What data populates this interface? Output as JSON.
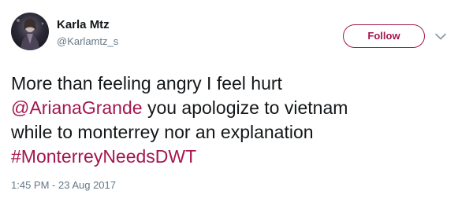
{
  "author": {
    "display_name": "Karla Mtz",
    "handle": "@Karlamtz_s"
  },
  "follow_label": "Follow",
  "tweet": {
    "line1": "More than feeling angry I feel hurt",
    "mention": "@ArianaGrande",
    "line2_rest": " you apologize to vietnam",
    "line3": "while to monterrey nor an explanation",
    "hashtag": "#MonterreyNeedsDWT"
  },
  "timestamp": "1:45 PM - 23 Aug 2017",
  "colors": {
    "accent": "#a3174f",
    "text": "#14171a",
    "secondary": "#657786"
  },
  "icons": {
    "caret": "chevron-down-icon",
    "avatar": "avatar"
  }
}
